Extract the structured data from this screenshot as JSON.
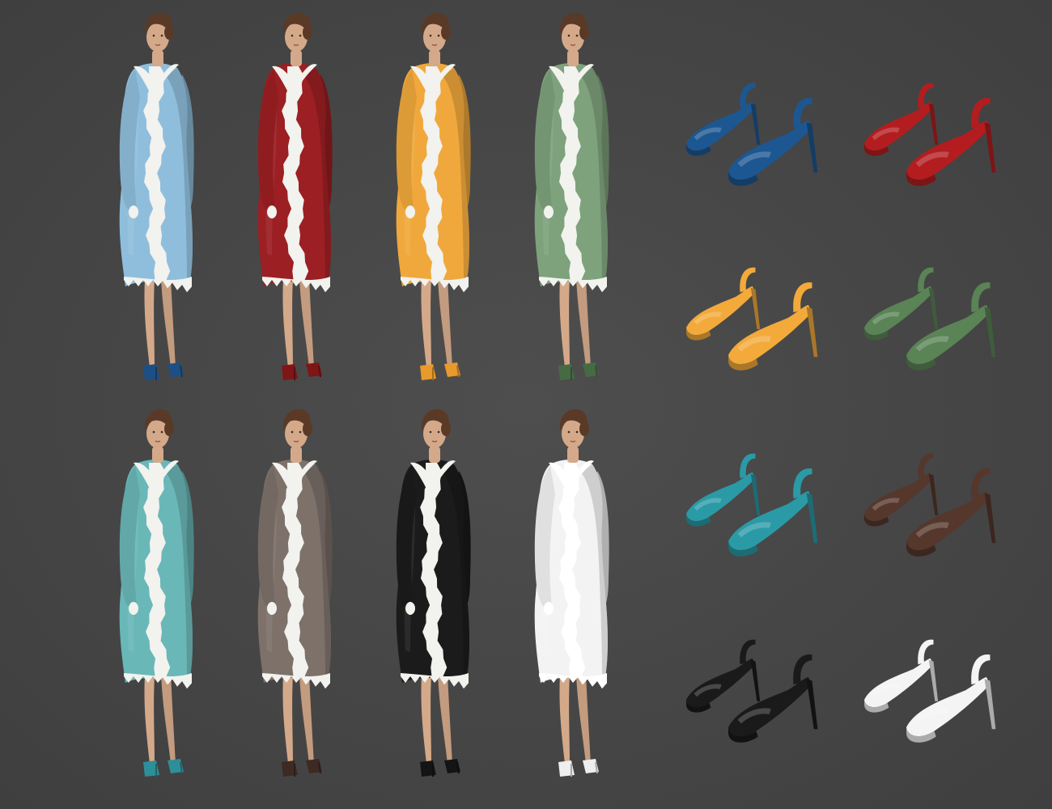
{
  "background": "#474747",
  "figures": [
    {
      "id": "light-blue",
      "dress": "#8fbedc",
      "shoe": "#1d4f86",
      "trim": "#f2f2ee"
    },
    {
      "id": "red",
      "dress": "#9b1f23",
      "shoe": "#7e1618",
      "trim": "#f2f2ee"
    },
    {
      "id": "yellow",
      "dress": "#f0a83c",
      "shoe": "#e89a2c",
      "trim": "#f2f2ee"
    },
    {
      "id": "green",
      "dress": "#7ea27c",
      "shoe": "#466b44",
      "trim": "#f2f2ee"
    },
    {
      "id": "teal",
      "dress": "#6ab7b8",
      "shoe": "#2d8f99",
      "trim": "#f2f2ee"
    },
    {
      "id": "taupe",
      "dress": "#7d716a",
      "shoe": "#3d2a22",
      "trim": "#f2f2ee"
    },
    {
      "id": "black",
      "dress": "#1b1b1b",
      "shoe": "#141414",
      "trim": "#f2f2ee"
    },
    {
      "id": "white",
      "dress": "#f3f3f3",
      "shoe": "#eeeeee",
      "trim": "#ffffff"
    }
  ],
  "shoes": [
    {
      "id": "navy",
      "color": "#1d5792"
    },
    {
      "id": "red",
      "color": "#b31d1f"
    },
    {
      "id": "yellow",
      "color": "#f3aa3b"
    },
    {
      "id": "green",
      "color": "#5a8356"
    },
    {
      "id": "teal",
      "color": "#2a9aa6"
    },
    {
      "id": "brown",
      "color": "#55372c"
    },
    {
      "id": "black",
      "color": "#1a1a1a"
    },
    {
      "id": "white",
      "color": "#f4f4f4"
    }
  ],
  "skin": "#d4a98a",
  "hair": "#5a3a26"
}
